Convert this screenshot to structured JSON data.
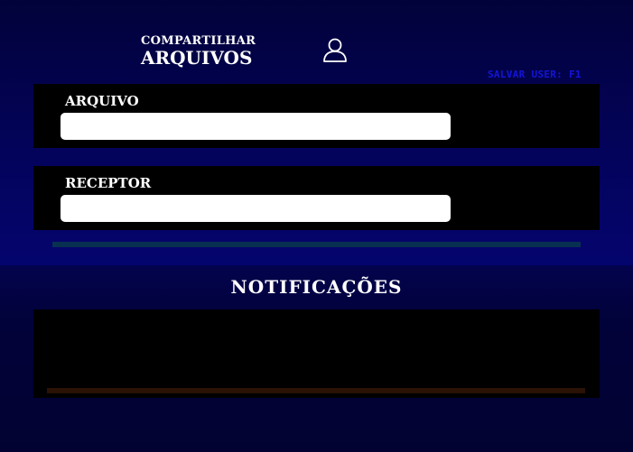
{
  "header": {
    "title_line1": "COMPARTILHAR",
    "title_line2": "ARQUIVOS",
    "user_icon": "user-icon",
    "save_hint": "SALVAR USER: F1"
  },
  "form": {
    "file": {
      "label": "ARQUIVO",
      "value": "",
      "placeholder": ""
    },
    "receiver": {
      "label": "RECEPTOR",
      "value": "",
      "placeholder": ""
    }
  },
  "transfer_progress": {
    "value": 0
  },
  "notifications": {
    "title": "NOTIFICAÇÕES",
    "items": []
  },
  "colors": {
    "background": "#02022e",
    "panel": "#000000",
    "save_hint": "#1414d8",
    "progress_track": "#083050"
  }
}
